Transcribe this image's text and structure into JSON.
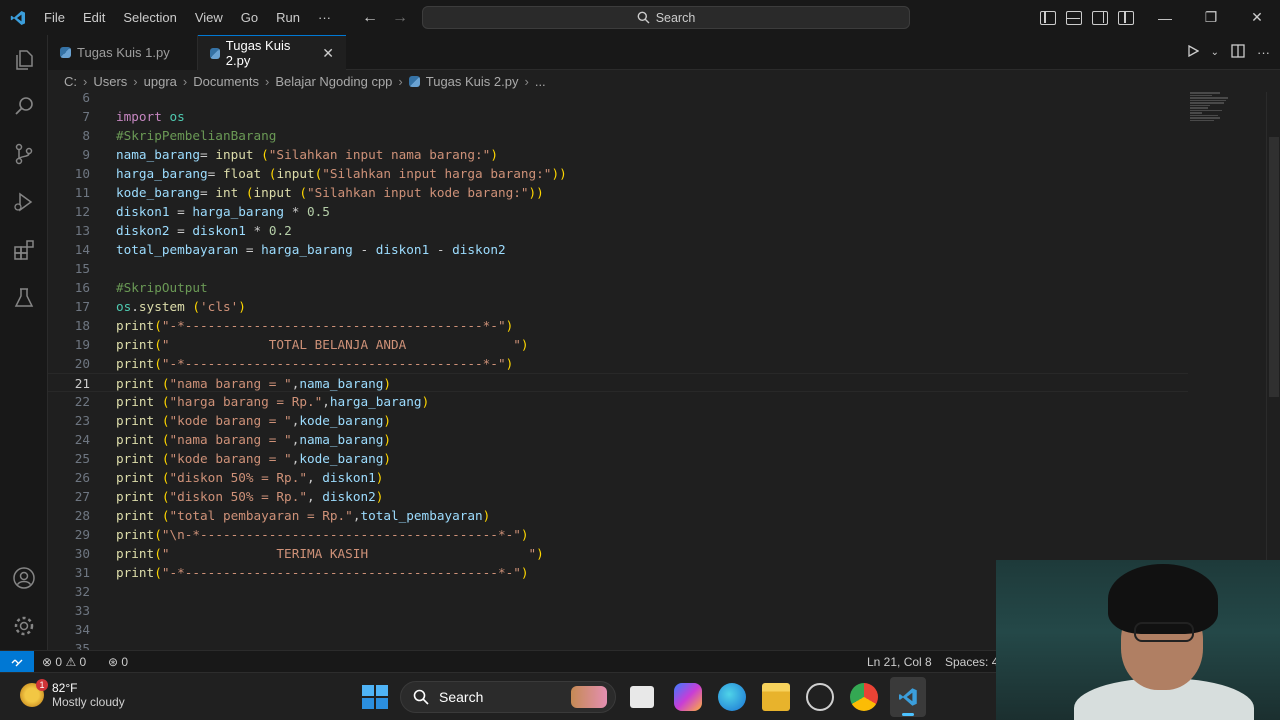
{
  "menu": {
    "items": [
      "File",
      "Edit",
      "Selection",
      "View",
      "Go",
      "Run",
      "···"
    ]
  },
  "search": {
    "label": "Search"
  },
  "tabs": [
    {
      "label": "Tugas Kuis 1.py",
      "active": false
    },
    {
      "label": "Tugas Kuis 2.py",
      "active": true
    }
  ],
  "breadcrumb": [
    "C:",
    "Users",
    "upgra",
    "Documents",
    "Belajar Ngoding cpp",
    "Tugas Kuis 2.py",
    "..."
  ],
  "editor": {
    "current_line": 21,
    "lines": [
      {
        "n": "6",
        "t": ""
      },
      {
        "n": "7",
        "t": "import os"
      },
      {
        "n": "8",
        "t": "#SkripPembelianBarang"
      },
      {
        "n": "9",
        "t": "nama_barang= input (\"Silahkan input nama barang:\")"
      },
      {
        "n": "10",
        "t": "harga_barang= float (input(\"Silahkan input harga barang:\"))"
      },
      {
        "n": "11",
        "t": "kode_barang= int (input (\"Silahkan input kode barang:\"))"
      },
      {
        "n": "12",
        "t": "diskon1 = harga_barang * 0.5"
      },
      {
        "n": "13",
        "t": "diskon2 = diskon1 * 0.2"
      },
      {
        "n": "14",
        "t": "total_pembayaran = harga_barang - diskon1 - diskon2"
      },
      {
        "n": "15",
        "t": ""
      },
      {
        "n": "16",
        "t": "#SkripOutput"
      },
      {
        "n": "17",
        "t": "os.system ('cls')"
      },
      {
        "n": "18",
        "t": "print(\"-*---------------------------------------*-\")"
      },
      {
        "n": "19",
        "t": "print(\"             TOTAL BELANJA ANDA              \")"
      },
      {
        "n": "20",
        "t": "print(\"-*---------------------------------------*-\")"
      },
      {
        "n": "21",
        "t": "print (\"nama barang = \",nama_barang)"
      },
      {
        "n": "22",
        "t": "print (\"harga barang = Rp.\",harga_barang)"
      },
      {
        "n": "23",
        "t": "print (\"kode barang = \",kode_barang)"
      },
      {
        "n": "24",
        "t": "print (\"nama barang = \",nama_barang)"
      },
      {
        "n": "25",
        "t": "print (\"kode barang = \",kode_barang)"
      },
      {
        "n": "26",
        "t": "print (\"diskon 50% = Rp.\", diskon1)"
      },
      {
        "n": "27",
        "t": "print (\"diskon 50% = Rp.\", diskon2)"
      },
      {
        "n": "28",
        "t": "print (\"total pembayaran = Rp.\",total_pembayaran)"
      },
      {
        "n": "29",
        "t": "print(\"\\n-*---------------------------------------*-\")"
      },
      {
        "n": "30",
        "t": "print(\"              TERIMA KASIH                     \")"
      },
      {
        "n": "31",
        "t": "print(\"-*-----------------------------------------*-\")"
      },
      {
        "n": "32",
        "t": ""
      },
      {
        "n": "33",
        "t": ""
      },
      {
        "n": "34",
        "t": ""
      },
      {
        "n": "35",
        "t": ""
      }
    ]
  },
  "status": {
    "errors": "0",
    "warnings": "0",
    "ports": "0",
    "cursor": "Ln 21, Col 8",
    "indent": "Spaces: 4"
  },
  "taskbar": {
    "weather_temp": "82°F",
    "weather_desc": "Mostly cloudy",
    "weather_badge": "1",
    "search_label": "Search"
  },
  "colors": {
    "accent": "#0078d4",
    "keyword": "#c586c0",
    "variable": "#9cdcfe",
    "function": "#dcdcaa",
    "string": "#ce9178",
    "number": "#b5cea8",
    "comment": "#6a9955"
  }
}
